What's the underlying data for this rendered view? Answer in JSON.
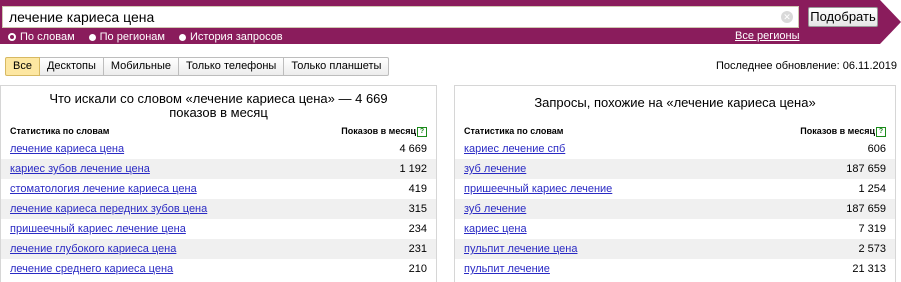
{
  "search": {
    "query": "лечение кариеса цена",
    "button_label": "Подобрать"
  },
  "modes": [
    {
      "label": "По словам",
      "selected": true
    },
    {
      "label": "По регионам",
      "selected": false
    },
    {
      "label": "История запросов",
      "selected": false
    }
  ],
  "regions_link": "Все регионы",
  "tabs": [
    {
      "label": "Все",
      "active": true
    },
    {
      "label": "Десктопы",
      "active": false
    },
    {
      "label": "Мобильные",
      "active": false
    },
    {
      "label": "Только телефоны",
      "active": false
    },
    {
      "label": "Только планшеты",
      "active": false
    }
  ],
  "last_update": "Последнее обновление: 06.11.2019",
  "left_panel": {
    "title": "Что искали со словом «лечение кариеса цена» — 4 669 показов в месяц",
    "col_phrase": "Статистика по словам",
    "col_count": "Показов в месяц",
    "rows": [
      {
        "phrase": "лечение кариеса цена",
        "count": "4 669"
      },
      {
        "phrase": "кариес зубов лечение цена",
        "count": "1 192"
      },
      {
        "phrase": "стоматология лечение кариеса цена",
        "count": "419"
      },
      {
        "phrase": "лечение кариеса передних зубов цена",
        "count": "315"
      },
      {
        "phrase": "пришеечный кариес лечение цена",
        "count": "234"
      },
      {
        "phrase": "лечение глубокого кариеса цена",
        "count": "231"
      },
      {
        "phrase": "лечение среднего кариеса цена",
        "count": "210"
      }
    ]
  },
  "right_panel": {
    "title": "Запросы, похожие на «лечение кариеса цена»",
    "col_phrase": "Статистика по словам",
    "col_count": "Показов в месяц",
    "rows": [
      {
        "phrase": "кариес лечение спб",
        "count": "606"
      },
      {
        "phrase": "зуб лечение",
        "count": "187 659"
      },
      {
        "phrase": "пришеечный кариес лечение",
        "count": "1 254"
      },
      {
        "phrase": "зуб лечение",
        "count": "187 659"
      },
      {
        "phrase": "кариес цена",
        "count": "7 319"
      },
      {
        "phrase": "пульпит лечение цена",
        "count": "2 573"
      },
      {
        "phrase": "пульпит лечение",
        "count": "21 313"
      }
    ]
  },
  "colors": {
    "band": "#8a1c5c",
    "link": "#2a2ac4",
    "active_tab": "#fde7a2"
  }
}
